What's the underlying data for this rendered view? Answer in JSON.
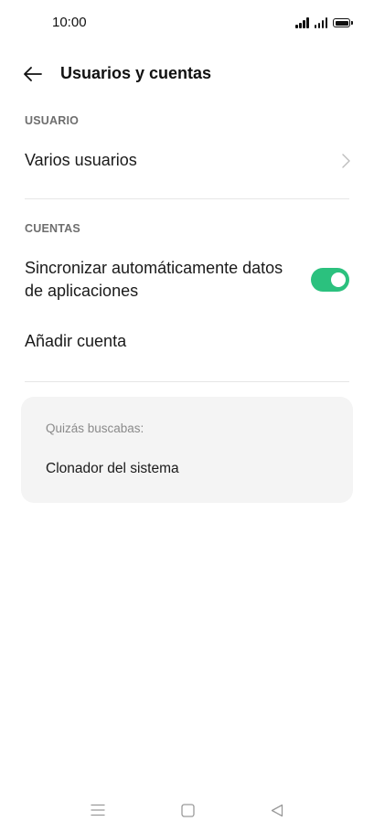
{
  "status_bar": {
    "time": "10:00",
    "icons": [
      "signal-icon",
      "signal-icon",
      "battery-icon"
    ]
  },
  "header": {
    "back_icon": "arrow-left-icon",
    "title": "Usuarios y cuentas"
  },
  "sections": {
    "usuario": {
      "label": "USUARIO",
      "items": [
        {
          "label": "Varios usuarios",
          "icon": "chevron-right-icon"
        }
      ]
    },
    "cuentas": {
      "label": "CUENTAS",
      "items": [
        {
          "label": "Sincronizar automáticamente datos de aplicaciones",
          "toggle_on": true
        },
        {
          "label": "Añadir cuenta"
        }
      ]
    }
  },
  "suggestions": {
    "header": "Quizás buscabas:",
    "items": [
      "Clonador del sistema"
    ]
  },
  "nav_bar": {
    "icons": [
      "menu-icon",
      "home-icon",
      "back-triangle-icon"
    ]
  },
  "colors": {
    "accent": "#2bc17e",
    "card_background": "#f4f4f4",
    "section_label": "#6e6e6e"
  }
}
